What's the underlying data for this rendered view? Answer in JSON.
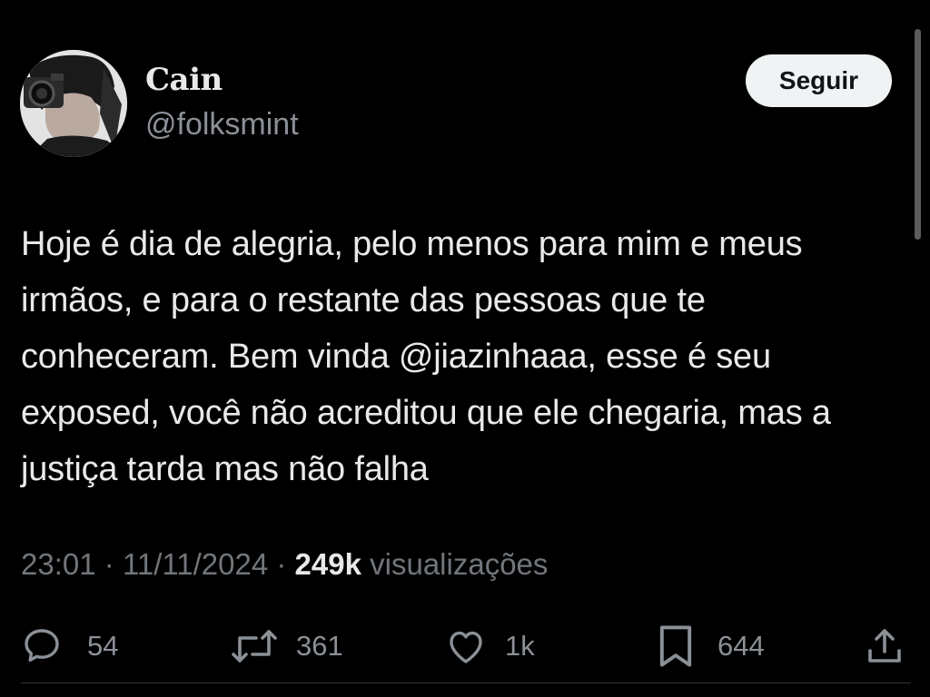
{
  "tweet": {
    "author_name": "Cain",
    "author_handle": "@folksmint",
    "follow_label": "Seguir",
    "text": "Hoje é dia de alegria, pelo menos para mim e meus irmãos, e para o restante das pessoas que te conheceram. Bem vinda @jiazinhaaa, esse é seu exposed, você não acreditou que ele chegaria, mas a justiça tarda mas não falha",
    "time": "23:01",
    "separator": "·",
    "date": "11/11/2024",
    "views_count": "249k",
    "views_label": "visualizações"
  },
  "actions": {
    "replies": {
      "icon": "reply-icon",
      "count": "54"
    },
    "retweets": {
      "icon": "retweet-icon",
      "count": "361"
    },
    "likes": {
      "icon": "heart-icon",
      "count": "1k"
    },
    "bookmarks": {
      "icon": "bookmark-icon",
      "count": "644"
    },
    "share": {
      "icon": "share-icon"
    }
  },
  "colors": {
    "background": "#000000",
    "text_primary": "#e7e9ea",
    "text_secondary": "#71767b",
    "follow_bg": "#eff3f4"
  }
}
